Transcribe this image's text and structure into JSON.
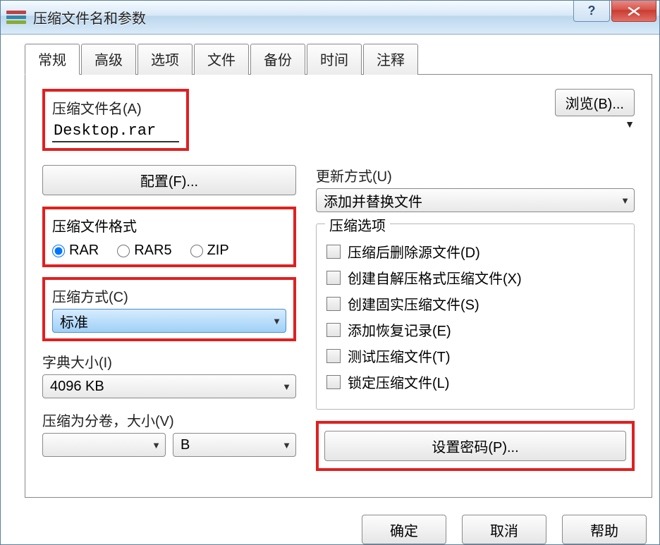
{
  "window": {
    "title": "压缩文件名和参数"
  },
  "tabs": [
    "常规",
    "高级",
    "选项",
    "文件",
    "备份",
    "时间",
    "注释"
  ],
  "active_tab": 0,
  "filename": {
    "label": "压缩文件名(A)",
    "value": "Desktop.rar",
    "browse": "浏览(B)..."
  },
  "profiles_btn": "配置(F)...",
  "update": {
    "label": "更新方式(U)",
    "selected": "添加并替换文件"
  },
  "format": {
    "legend": "压缩文件格式",
    "options": [
      "RAR",
      "RAR5",
      "ZIP"
    ],
    "selected": "RAR"
  },
  "method": {
    "label": "压缩方式(C)",
    "selected": "标准"
  },
  "dict": {
    "label": "字典大小(I)",
    "selected": "4096 KB"
  },
  "split": {
    "label": "压缩为分卷，大小(V)",
    "value": "",
    "unit": "B"
  },
  "archive_options": {
    "legend": "压缩选项",
    "items": [
      "压缩后删除源文件(D)",
      "创建自解压格式压缩文件(X)",
      "创建固实压缩文件(S)",
      "添加恢复记录(E)",
      "测试压缩文件(T)",
      "锁定压缩文件(L)"
    ]
  },
  "password_btn": "设置密码(P)...",
  "buttons": {
    "ok": "确定",
    "cancel": "取消",
    "help": "帮助"
  }
}
